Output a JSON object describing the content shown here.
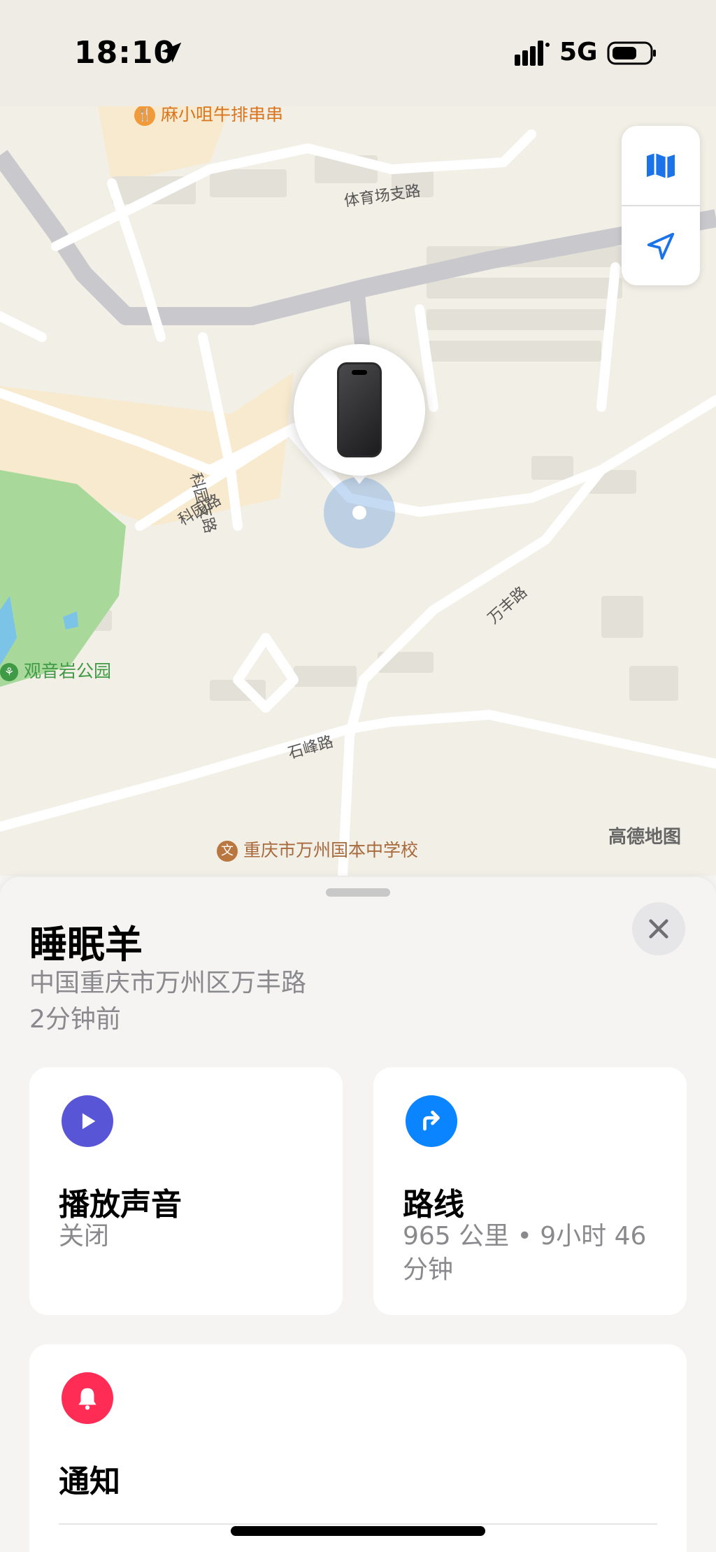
{
  "status_bar": {
    "time": "18:10",
    "network": "5G"
  },
  "map": {
    "roads": [
      {
        "label": "体育场支路"
      },
      {
        "label": "科园支路"
      },
      {
        "label": "科园路"
      },
      {
        "label": "万丰路"
      },
      {
        "label": "石峰路"
      }
    ],
    "pois": [
      {
        "label": "麻小咀牛排串串",
        "color": "#d9751f"
      },
      {
        "label": "观音岩公园",
        "color": "#3f9a45"
      },
      {
        "label": "重庆市万州国本中学校",
        "color": "#a86a3c"
      }
    ],
    "attribution": "高德地图",
    "accuracy_color": "#5a96dc"
  },
  "device": {
    "name": "睡眠羊",
    "address": "中国重庆市万州区万丰路",
    "last_seen": "2分钟前"
  },
  "actions": {
    "play_sound": {
      "title": "播放声音",
      "status": "关闭",
      "icon": "play-icon",
      "color": "#5856d6"
    },
    "directions": {
      "title": "路线",
      "detail": "965 公里 • 9小时 46 分钟",
      "icon": "turn-right-arrow-icon",
      "color": "#0a84ff"
    },
    "notifications": {
      "title": "通知",
      "icon": "bell-icon",
      "color": "#ff2d55"
    }
  }
}
